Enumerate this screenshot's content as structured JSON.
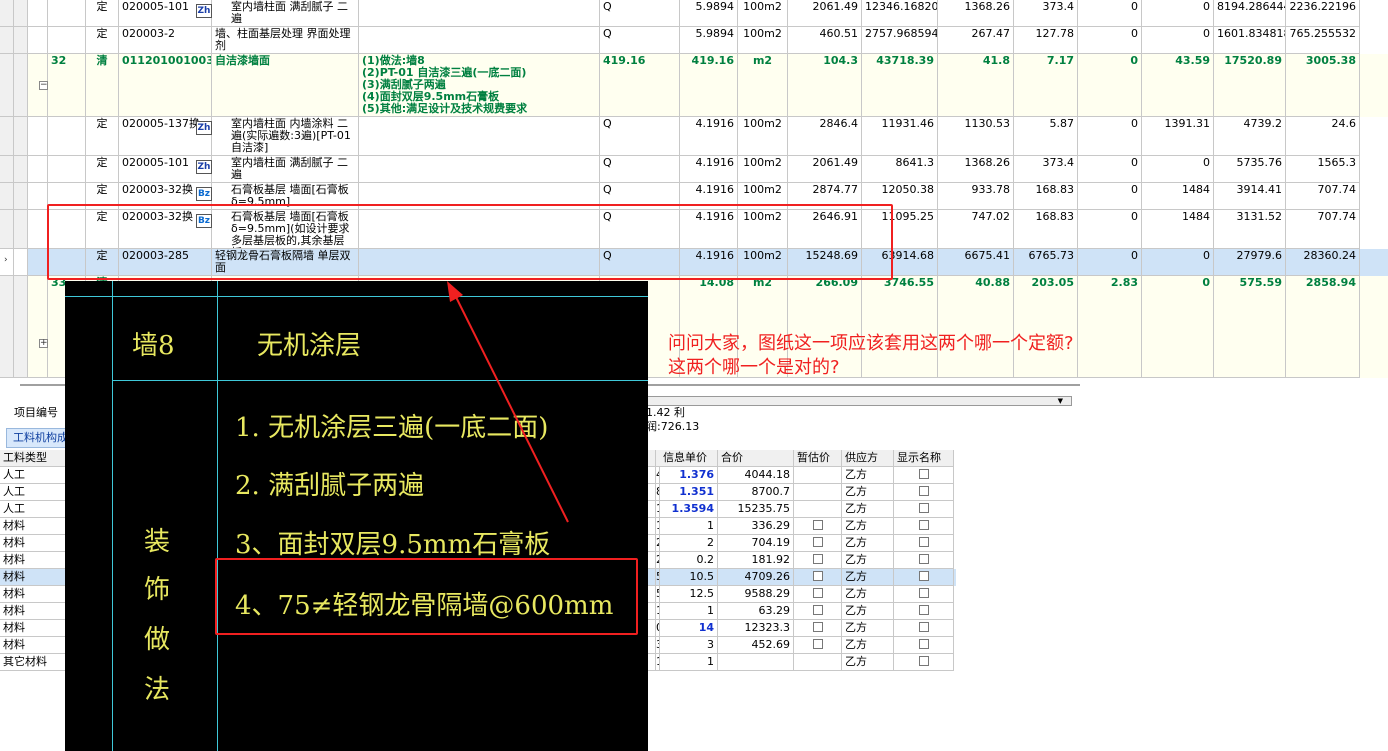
{
  "top_rows": [
    {
      "no": "",
      "type": "定",
      "code": "020005-101",
      "badge": "Zh",
      "name": "室内墙柱面 满刮腻子 二遍",
      "desc": "",
      "expr": "Q",
      "qty1": "",
      "qty2": "5.9894",
      "unit": "100m2",
      "p1": "2061.49",
      "p2": "12346.168206",
      "p3": "1368.26",
      "p4": "373.4",
      "p5": "0",
      "p6": "0",
      "p7": "8194.286444",
      "p8": "2236.22196"
    },
    {
      "no": "",
      "type": "定",
      "code": "020003-2",
      "badge": "",
      "name": "墙、柱面基层处理 界面处理剂",
      "desc": "",
      "expr": "Q",
      "qty1": "",
      "qty2": "5.9894",
      "unit": "100m2",
      "p1": "460.51",
      "p2": "2757.968594",
      "p3": "267.47",
      "p4": "127.78",
      "p5": "0",
      "p6": "0",
      "p7": "1601.834818",
      "p8": "765.255532"
    },
    {
      "no": "32",
      "type": "清",
      "code": "011201001003",
      "badge": "",
      "name": "自洁漆墙面",
      "desc": "(1)做法:墙8\n(2)PT-01 自洁漆三遍(一底二面)\n(3)满刮腻子两遍\n(4)面封双层9.5mm石膏板\n(5)其他:满足设计及技术规费要求",
      "expr": "419.16",
      "qty1": "",
      "qty2": "419.16",
      "unit": "m2",
      "p1": "104.3",
      "p2": "43718.39",
      "p3": "41.8",
      "p4": "7.17",
      "p5": "0",
      "p6": "43.59",
      "p7": "17520.89",
      "p8": "3005.38"
    },
    {
      "no": "",
      "type": "定",
      "code": "020005-137换",
      "badge": "Zh",
      "name": "室内墙柱面 内墙涂料 二遍(实际遍数:3遍)[PT-01 自洁漆]",
      "desc": "",
      "expr": "Q",
      "qty1": "",
      "qty2": "4.1916",
      "unit": "100m2",
      "p1": "2846.4",
      "p2": "11931.46",
      "p3": "1130.53",
      "p4": "5.87",
      "p5": "0",
      "p6": "1391.31",
      "p7": "4739.2",
      "p8": "24.6"
    },
    {
      "no": "",
      "type": "定",
      "code": "020005-101",
      "badge": "Zh",
      "name": "室内墙柱面 满刮腻子 二遍",
      "desc": "",
      "expr": "Q",
      "qty1": "",
      "qty2": "4.1916",
      "unit": "100m2",
      "p1": "2061.49",
      "p2": "8641.3",
      "p3": "1368.26",
      "p4": "373.4",
      "p5": "0",
      "p6": "0",
      "p7": "5735.76",
      "p8": "1565.3"
    },
    {
      "no": "",
      "type": "定",
      "code": "020003-32换",
      "badge": "Bz",
      "name": "石膏板基层 墙面[石膏板 δ=9.5mm]",
      "desc": "",
      "expr": "Q",
      "qty1": "",
      "qty2": "4.1916",
      "unit": "100m2",
      "p1": "2874.77",
      "p2": "12050.38",
      "p3": "933.78",
      "p4": "168.83",
      "p5": "0",
      "p6": "1484",
      "p7": "3914.41",
      "p8": "707.74"
    },
    {
      "no": "",
      "type": "定",
      "code": "020003-32换",
      "badge": "Bz",
      "name": "石膏板基层 墙面[石膏板 δ=9.5mm](如设计要求多层基层板的,其余基层板)",
      "desc": "",
      "expr": "Q",
      "qty1": "",
      "qty2": "4.1916",
      "unit": "100m2",
      "p1": "2646.91",
      "p2": "11095.25",
      "p3": "747.02",
      "p4": "168.83",
      "p5": "0",
      "p6": "1484",
      "p7": "3131.52",
      "p8": "707.74"
    },
    {
      "no": "",
      "type": "定",
      "code": "020003-285",
      "badge": "",
      "name": "轻钢龙骨石膏板隔墙 单层双面",
      "desc": "",
      "expr": "Q",
      "qty1": "",
      "qty2": "4.1916",
      "unit": "100m2",
      "p1": "15248.69",
      "p2": "63914.68",
      "p3": "6675.41",
      "p4": "6765.73",
      "p5": "0",
      "p6": "0",
      "p7": "27979.6",
      "p8": "28360.24"
    },
    {
      "no": "33",
      "type": "清",
      "code": "",
      "badge": "",
      "name": "",
      "desc": "",
      "expr": "",
      "qty1": "",
      "qty2": "14.08",
      "unit": "m2",
      "p1": "266.09",
      "p2": "3746.55",
      "p3": "40.88",
      "p4": "203.05",
      "p5": "2.83",
      "p6": "0",
      "p7": "575.59",
      "p8": "2858.94"
    }
  ],
  "props": {
    "label": "项目编号",
    "tail": "1.42   利润:726.13"
  },
  "tab_label": "工料机构成",
  "res_headers": {
    "type": "工料类型",
    "info_price": "信息单价",
    "total": "合价",
    "estimate": "暂估价",
    "supplier": "供应方",
    "show_name": "显示名称"
  },
  "res_rows": [
    {
      "type": "人工",
      "qty": "4",
      "price": "1.376",
      "total": "4044.18",
      "chk": false,
      "sup": "乙方",
      "blue": true
    },
    {
      "type": "人工",
      "qty": "8",
      "price": "1.351",
      "total": "8700.7",
      "chk": false,
      "sup": "乙方",
      "blue": true
    },
    {
      "type": "人工",
      "qty": "1",
      "price": "1.3594",
      "total": "15235.75",
      "chk": false,
      "sup": "乙方",
      "blue": true
    },
    {
      "type": "材料",
      "qty": "1",
      "price": "1",
      "total": "336.29",
      "chk": true,
      "sup": "乙方",
      "blue": false
    },
    {
      "type": "材料",
      "qty": "2",
      "price": "2",
      "total": "704.19",
      "chk": true,
      "sup": "乙方",
      "blue": false
    },
    {
      "type": "材料",
      "qty": "2",
      "price": "0.2",
      "total": "181.92",
      "chk": true,
      "sup": "乙方",
      "blue": false
    },
    {
      "type": "材料",
      "qty": "5",
      "price": "10.5",
      "total": "4709.26",
      "chk": true,
      "sup": "乙方",
      "blue": false
    },
    {
      "type": "材料",
      "qty": "5",
      "price": "12.5",
      "total": "9588.29",
      "chk": true,
      "sup": "乙方",
      "blue": false
    },
    {
      "type": "材料",
      "qty": "1",
      "price": "1",
      "total": "63.29",
      "chk": true,
      "sup": "乙方",
      "blue": false
    },
    {
      "type": "材料",
      "qty": "0",
      "price": "14",
      "total": "12323.3",
      "chk": true,
      "sup": "乙方",
      "blue": true
    },
    {
      "type": "材料",
      "qty": "3",
      "price": "3",
      "total": "452.69",
      "chk": true,
      "sup": "乙方",
      "blue": false
    },
    {
      "type": "其它材料",
      "qty": "1",
      "price": "1",
      "total": "",
      "chk": false,
      "sup": "乙方",
      "blue": false
    }
  ],
  "cad": {
    "wall": "墙8",
    "coating": "无机涂层",
    "vertical": [
      "装",
      "饰",
      "做",
      "法"
    ],
    "items": [
      "1. 无机涂层三遍(一底二面)",
      "2. 满刮腻子两遍",
      "3、面封双层9.5mm石膏板",
      "4、75≠轻钢龙骨隔墙@600mm"
    ]
  },
  "question": {
    "line1": "问问大家，图纸这一项应该套用这两个哪一个定额?",
    "line2": "这两个哪一个是对的?"
  },
  "colors": {
    "qing_text": "#008040",
    "selection": "#cfe3f7",
    "annotation": "#f02020",
    "cad_text": "#e8e860",
    "cad_line": "#3fc8d8"
  }
}
